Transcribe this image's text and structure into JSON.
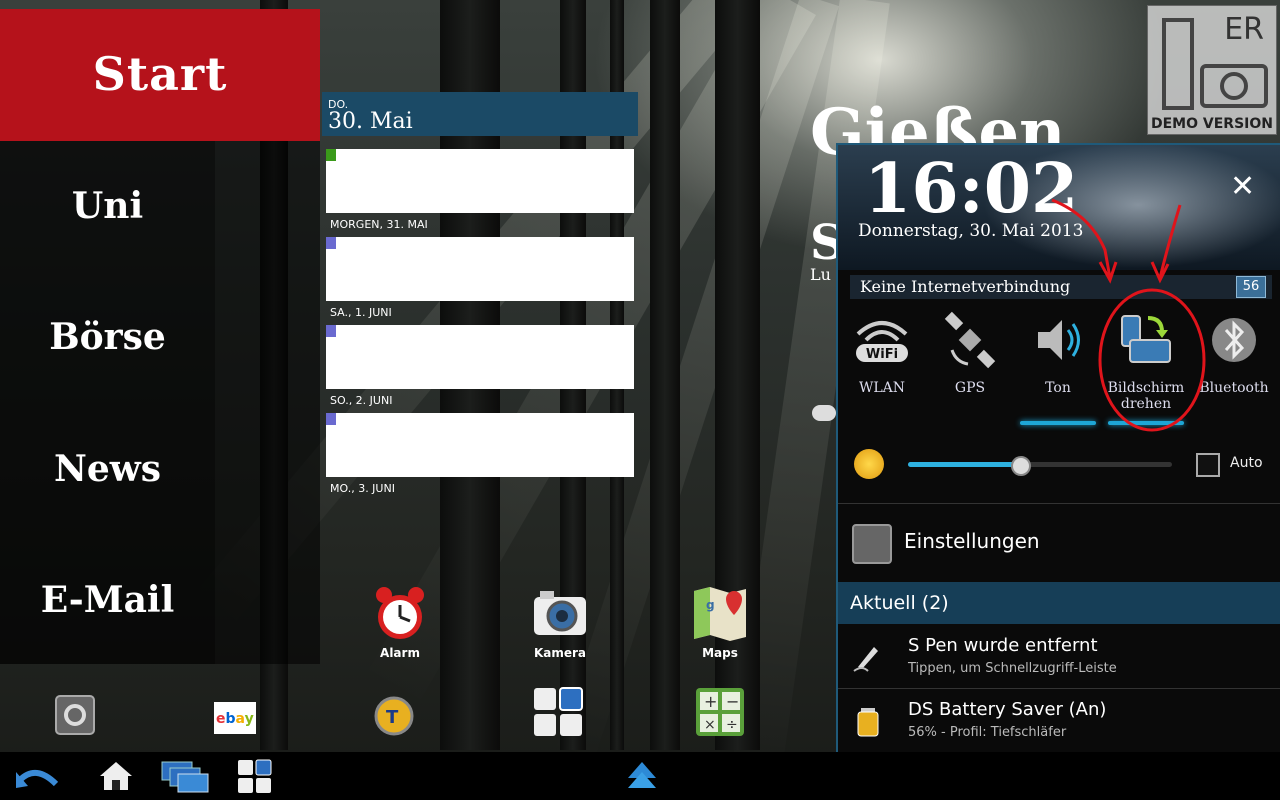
{
  "menu": {
    "start": "Start",
    "items": [
      "Uni",
      "Börse",
      "News",
      "E-Mail"
    ]
  },
  "calendar": {
    "header_dow": "DO.",
    "header_date": "30. Mai",
    "day_labels": [
      "MORGEN, 31. MAI",
      "SA., 1. JUNI",
      "SO., 2. JUNI",
      "MO., 3. JUNI"
    ],
    "marker_colors": [
      "#3a9a1a",
      "#6a6ad0",
      "#6a6ad0",
      "#6a6ad0"
    ]
  },
  "weather": {
    "city": "Gießen"
  },
  "demo_badge": {
    "er": "ER",
    "label": "DEMO VERSION"
  },
  "panel": {
    "time": "16:02",
    "date": "Donnerstag, 30. Mai 2013",
    "network_status": "Keine Internetverbindung",
    "network_badge": "56",
    "quick_settings": [
      {
        "label": "WLAN",
        "icon": "wifi-icon",
        "active": false
      },
      {
        "label": "GPS",
        "icon": "satellite-icon",
        "active": false
      },
      {
        "label": "Ton",
        "icon": "speaker-icon",
        "active": true
      },
      {
        "label": "Bildschirm drehen",
        "icon": "screen-rotate-icon",
        "active": true
      },
      {
        "label": "Bluetooth",
        "icon": "bluetooth-icon",
        "active": false
      }
    ],
    "brightness": {
      "level": 0.42,
      "auto_label": "Auto"
    },
    "settings_label": "Einstellungen",
    "aktuell_header": "Aktuell (2)",
    "notifications": [
      {
        "title": "S Pen wurde entfernt",
        "subtitle": "Tippen, um Schnellzugriff-Leiste",
        "icon": "pen-icon"
      },
      {
        "title": "DS Battery Saver (An)",
        "subtitle": "56% - Profil: Tiefschläfer",
        "icon": "battery-icon"
      }
    ]
  },
  "apps": [
    {
      "label": "Alarm",
      "icon": "alarm-clock-icon"
    },
    {
      "label": "Kamera",
      "icon": "camera-icon"
    },
    {
      "label": "Maps",
      "icon": "maps-icon"
    }
  ],
  "dock_apps": [
    {
      "icon": "settings-folder-icon"
    },
    {
      "label": "ebay",
      "icon": "ebay-icon"
    },
    {
      "icon": "settings-t-icon"
    },
    {
      "icon": "widget-grid-icon"
    },
    {
      "icon": "calculator-icon"
    }
  ],
  "bottom_bar": [
    {
      "icon": "back-icon"
    },
    {
      "icon": "home-icon"
    },
    {
      "icon": "recent-apps-icon"
    },
    {
      "icon": "grid-icon"
    },
    {
      "icon": "up-arrow-icon"
    }
  ],
  "colors": {
    "menu_accent": "#b5121b",
    "panel_accent": "#1ea6d6",
    "calendar_header": "#1b4a66",
    "annotation": "#e0141b"
  }
}
